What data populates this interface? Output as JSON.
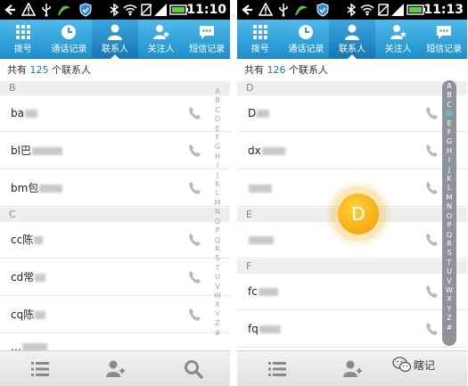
{
  "status": {
    "time_left": "11:10",
    "time_right": "11:13",
    "icons": [
      "back-arrow-icon",
      "warning-icon",
      "usb-icon",
      "grass-icon",
      "shield-icon",
      "bluetooth-icon",
      "wifi-icon",
      "no-sim-icon",
      "signal-icon",
      "battery-icon"
    ]
  },
  "tabs": [
    {
      "label": "拨号",
      "icon": "dialpad-icon"
    },
    {
      "label": "通话记录",
      "icon": "clock-icon"
    },
    {
      "label": "联系人",
      "icon": "person-icon"
    },
    {
      "label": "关注人",
      "icon": "star-person-icon"
    },
    {
      "label": "短信记录",
      "icon": "chat-icon"
    }
  ],
  "active_tab": "联系人",
  "left": {
    "count_prefix": "共有",
    "count": "125",
    "count_suffix": "个联系人",
    "sections": [
      {
        "letter": "B",
        "rows": [
          {
            "name": "ba"
          },
          {
            "name": "bl巴"
          },
          {
            "name": "bm包"
          }
        ]
      },
      {
        "letter": "C",
        "rows": [
          {
            "name": "cc陈"
          },
          {
            "name": "cd常"
          },
          {
            "name": "cq陈"
          },
          {
            "name": "…"
          }
        ]
      }
    ]
  },
  "right": {
    "count_prefix": "共有",
    "count": "126",
    "count_suffix": "个联系人",
    "sections": [
      {
        "letter": "D",
        "rows": [
          {
            "name": "D"
          },
          {
            "name": "dx"
          },
          {
            "name": ""
          }
        ]
      },
      {
        "letter": "E",
        "rows": [
          {
            "name": ""
          }
        ]
      },
      {
        "letter": "F",
        "rows": [
          {
            "name": "fc"
          },
          {
            "name": "fq"
          }
        ]
      }
    ],
    "popup_letter": "D"
  },
  "index_letters": [
    "A",
    "B",
    "C",
    "D",
    "E",
    "F",
    "G",
    "H",
    "I",
    "J",
    "K",
    "L",
    "M",
    "N",
    "O",
    "P",
    "Q",
    "R",
    "S",
    "T",
    "U",
    "V",
    "W",
    "X",
    "Y",
    "Z",
    "#"
  ],
  "bottom": {
    "icons": [
      "list-icon",
      "add-contact-icon",
      "search-icon"
    ]
  },
  "watermark": {
    "text": "瞎记",
    "icon": "wechat-icon"
  },
  "colors": {
    "accent": "#1e90cf",
    "highlight": "#f6a800",
    "count": "#1e73be"
  }
}
